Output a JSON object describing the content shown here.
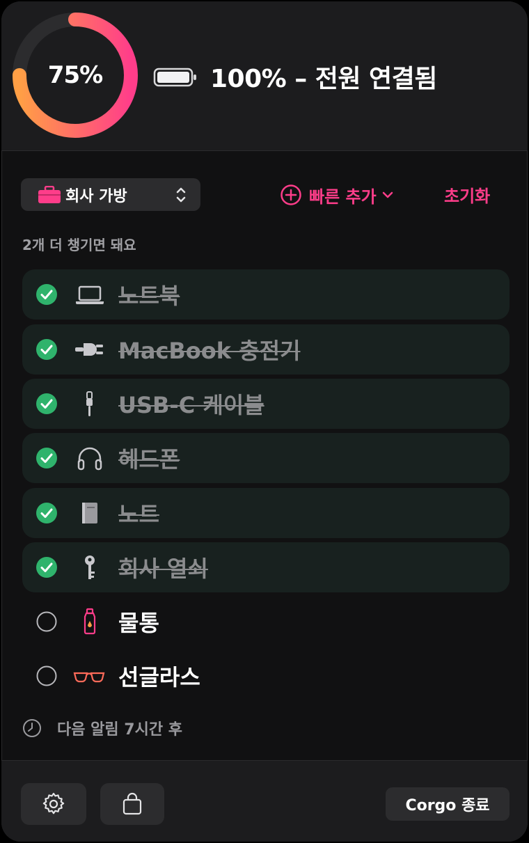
{
  "header": {
    "ring_percent": 75,
    "ring_label": "75%",
    "battery_text": "100% – 전원 연결됨"
  },
  "toolbar": {
    "bag_name": "회사 가방",
    "quick_add_label": "빠른 추가",
    "reset_label": "초기화"
  },
  "status": {
    "remaining_text": "2개 더 챙기면 돼요"
  },
  "items": [
    {
      "label": "노트북",
      "done": true,
      "icon": "laptop-icon"
    },
    {
      "label": "MacBook 충전기",
      "done": true,
      "icon": "power-plug-icon"
    },
    {
      "label": "USB-C 케이블",
      "done": true,
      "icon": "cable-icon"
    },
    {
      "label": "헤드폰",
      "done": true,
      "icon": "headphones-icon"
    },
    {
      "label": "노트",
      "done": true,
      "icon": "notebook-icon"
    },
    {
      "label": "회사 열쇠",
      "done": true,
      "icon": "key-icon"
    },
    {
      "label": "물통",
      "done": false,
      "icon": "water-bottle-icon"
    },
    {
      "label": "선글라스",
      "done": false,
      "icon": "sunglasses-icon"
    }
  ],
  "next_alarm": {
    "text": "다음 알림 7시간 후"
  },
  "footer": {
    "quit_label": "Corgo 종료"
  },
  "colors": {
    "accent": "#ff3d8a",
    "check_green": "#2fb36c",
    "ring_start": "#ff9f45",
    "ring_end": "#ff3d8a"
  }
}
